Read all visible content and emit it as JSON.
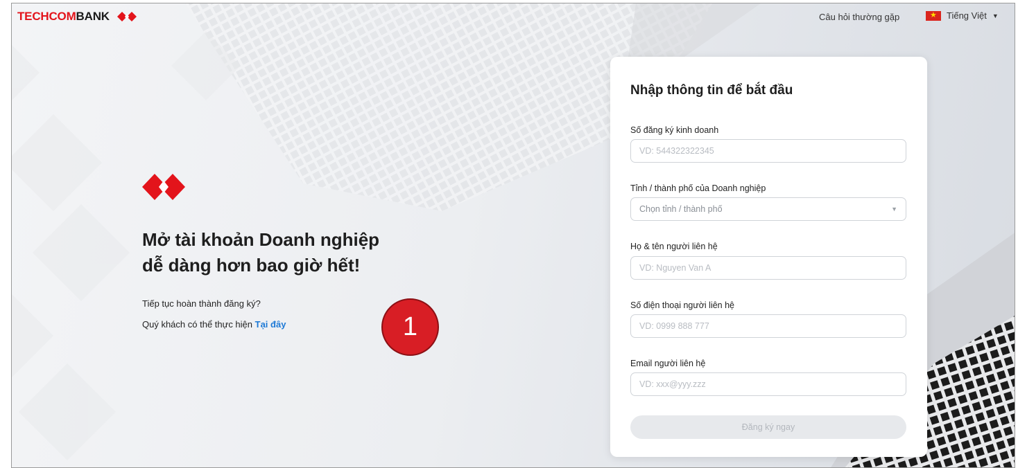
{
  "brand": {
    "name_red": "TECHCOM",
    "name_dark": "BANK",
    "primary_color": "#e3141b",
    "logo_icon": "techcombank-diamond-logo-icon"
  },
  "topnav": {
    "faq": "Câu hỏi thường gặp",
    "language": "Tiếng Việt",
    "flag_icon": "vietnam-flag-icon",
    "dropdown_icon": "caret-down-icon"
  },
  "hero": {
    "title_line1": "Mở tài khoản Doanh nghiệp",
    "title_line2": "dễ dàng hơn bao giờ hết!",
    "continue_question": "Tiếp tục hoàn thành đăng ký?",
    "continue_prefix": "Quý khách có thể thực hiện",
    "continue_link": "Tại đây"
  },
  "step_badge": "1",
  "form": {
    "title": "Nhập thông tin để bắt đầu",
    "business_reg": {
      "label": "Số đăng ký kinh doanh",
      "placeholder": "VD: 544322322345",
      "value": ""
    },
    "province": {
      "label": "Tỉnh / thành phố của Doanh nghiệp",
      "placeholder": "Chọn tỉnh / thành phố"
    },
    "contact_name": {
      "label": "Họ & tên người liên hệ",
      "placeholder": "VD: Nguyen Van A",
      "value": ""
    },
    "contact_phone": {
      "label": "Số điện thoại người liên hệ",
      "placeholder": "VD: 0999 888 777",
      "value": ""
    },
    "contact_email": {
      "label": "Email người liên hệ",
      "placeholder": "VD: xxx@yyy.zzz",
      "value": ""
    },
    "submit": "Đăng ký ngay"
  }
}
